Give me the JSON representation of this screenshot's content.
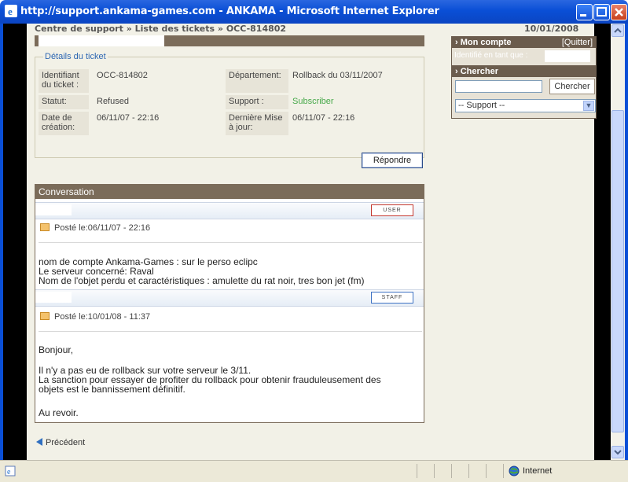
{
  "window": {
    "title": "http://support.ankama-games.com - ANKAMA - Microsoft Internet Explorer"
  },
  "header": {
    "breadcrumb": "Centre de support » Liste des tickets » OCC-814802",
    "date": "10/01/2008"
  },
  "details": {
    "legend": "Détails du ticket",
    "id_label": "Identifiant du ticket :",
    "id_value": "OCC-814802",
    "dept_label": "Département:",
    "dept_value": "Rollback du 03/11/2007",
    "status_label": "Statut:",
    "status_value": "Refused",
    "support_label": "Support :",
    "support_value": "Subscriber",
    "created_label": "Date de création:",
    "created_value": "06/11/07 - 22:16",
    "updated_label": "Dernière Mise à jour:",
    "updated_value": "06/11/07 - 22:16"
  },
  "actions": {
    "reply": "Répondre",
    "previous": "Précédent"
  },
  "conversation": {
    "title": "Conversation",
    "messages": [
      {
        "tag": "USER",
        "posted": "Posté le:06/11/07 - 22:16",
        "lines": [
          "nom de compte Ankama-Games :                sur le perso eclipc",
          "Le serveur concerné: Raval",
          "Nom de l'objet perdu et caractéristiques : amulette du rat noir, tres bon jet (fm)"
        ]
      },
      {
        "tag": "STAFF",
        "posted": "Posté le:10/01/08 - 11:37",
        "lines": [
          "Bonjour,",
          "",
          "Il n'y a pas eu de rollback sur votre serveur le 3/11.",
          "La sanction pour essayer de profiter du rollback pour obtenir frauduleusement des",
          "objets est le bannissement définitif.",
          "",
          "Au revoir."
        ]
      }
    ]
  },
  "sidebar": {
    "account_title": "Mon compte",
    "quit": "[Quitter]",
    "logged_as": "Identifié en tant que :",
    "search_title": "Chercher",
    "search_button": "Chercher",
    "support_select": "-- Support --"
  },
  "statusbar": {
    "zone": "Internet"
  },
  "colors": {
    "title_bar": "#0a4fd6",
    "brown": "#7b6c5a",
    "page_bg": "#f2f1e7",
    "support_green": "#47a94a",
    "legend_blue": "#2c66b2"
  }
}
